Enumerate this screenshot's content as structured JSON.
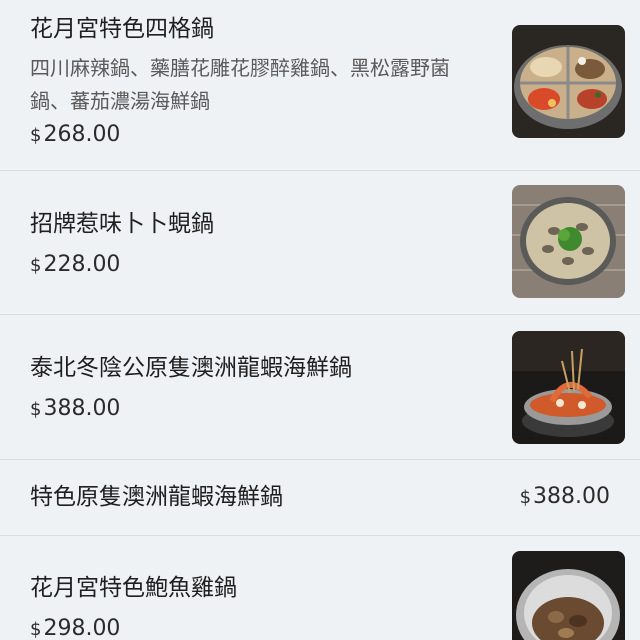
{
  "currency_symbol": "$",
  "items": [
    {
      "name": "花月宮特色四格鍋",
      "description": "四川麻辣鍋、藥膳花雕花膠醉雞鍋、黑松露野菌鍋、蕃茄濃湯海鮮鍋",
      "price": "268.00",
      "image": "four-grid-hotpot-photo"
    },
    {
      "name": "招牌惹味卜卜蜆鍋",
      "price": "228.00",
      "image": "clam-hotpot-photo"
    },
    {
      "name": "泰北冬陰公原隻澳洲龍蝦海鮮鍋",
      "price": "388.00",
      "image": "tom-yum-lobster-hotpot-photo"
    },
    {
      "name": "特色原隻澳洲龍蝦海鮮鍋",
      "price": "388.00"
    },
    {
      "name": "花月宮特色鮑魚雞鍋",
      "price": "298.00",
      "image": "abalone-chicken-hotpot-photo"
    }
  ]
}
